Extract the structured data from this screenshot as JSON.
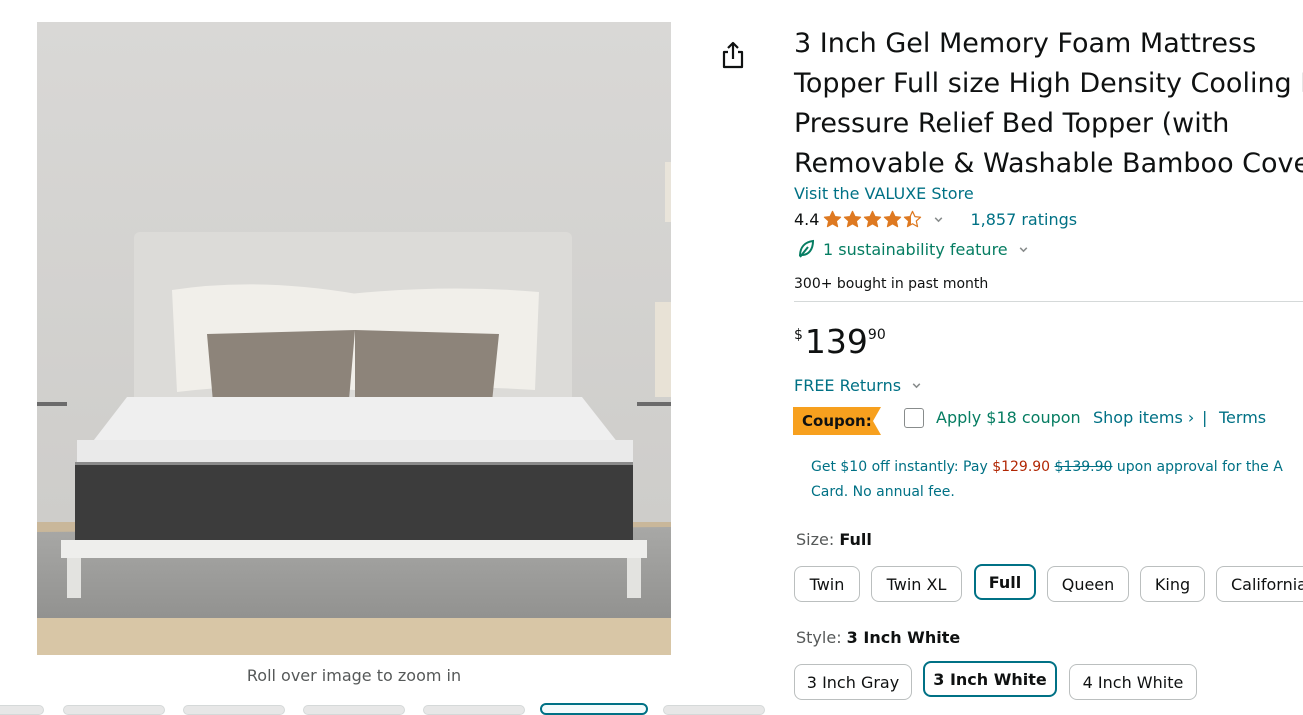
{
  "image": {
    "zoom_hint": "Roll over image to zoom in",
    "thumbnail_count": 7,
    "active_thumbnail": 5
  },
  "share_icon": "share-icon",
  "product": {
    "title": "3 Inch Gel Memory Foam Mattress Topper Full size High Density Cooling Pad Pressure Relief Bed Topper (with Removable & Washable Bamboo Cover)",
    "store_link": "Visit the VALUXE Store",
    "rating_value": "4.4",
    "rating_stars": 4.4,
    "ratings_count": "1,857 ratings",
    "sustainability": "1 sustainability feature",
    "bought": "300+ bought in past month"
  },
  "price": {
    "symbol": "$",
    "whole": "139",
    "fraction": "90"
  },
  "returns": "FREE Returns",
  "coupon": {
    "badge": "Coupon:",
    "apply": "Apply $18 coupon",
    "shop": "Shop items ›",
    "separator": "|",
    "terms": "Terms"
  },
  "promo": {
    "prefix": "Get $10 off instantly: Pay ",
    "new_price": "$129.90",
    "old_price": "$139.90",
    "suffix": " upon approval for the A",
    "line2": "Card. No annual fee."
  },
  "size": {
    "label": "Size: ",
    "selected": "Full",
    "options": [
      "Twin",
      "Twin XL",
      "Full",
      "Queen",
      "King",
      "California"
    ]
  },
  "style": {
    "label": "Style: ",
    "selected": "3 Inch White",
    "options": [
      "3 Inch Gray",
      "3 Inch White",
      "4 Inch White"
    ]
  },
  "colors": {
    "link": "#007185",
    "star": "#de7921",
    "coupon_badge": "#f7a01e",
    "coupon_green": "#067d62",
    "price_red": "#b12704",
    "selected_border": "#007185"
  }
}
